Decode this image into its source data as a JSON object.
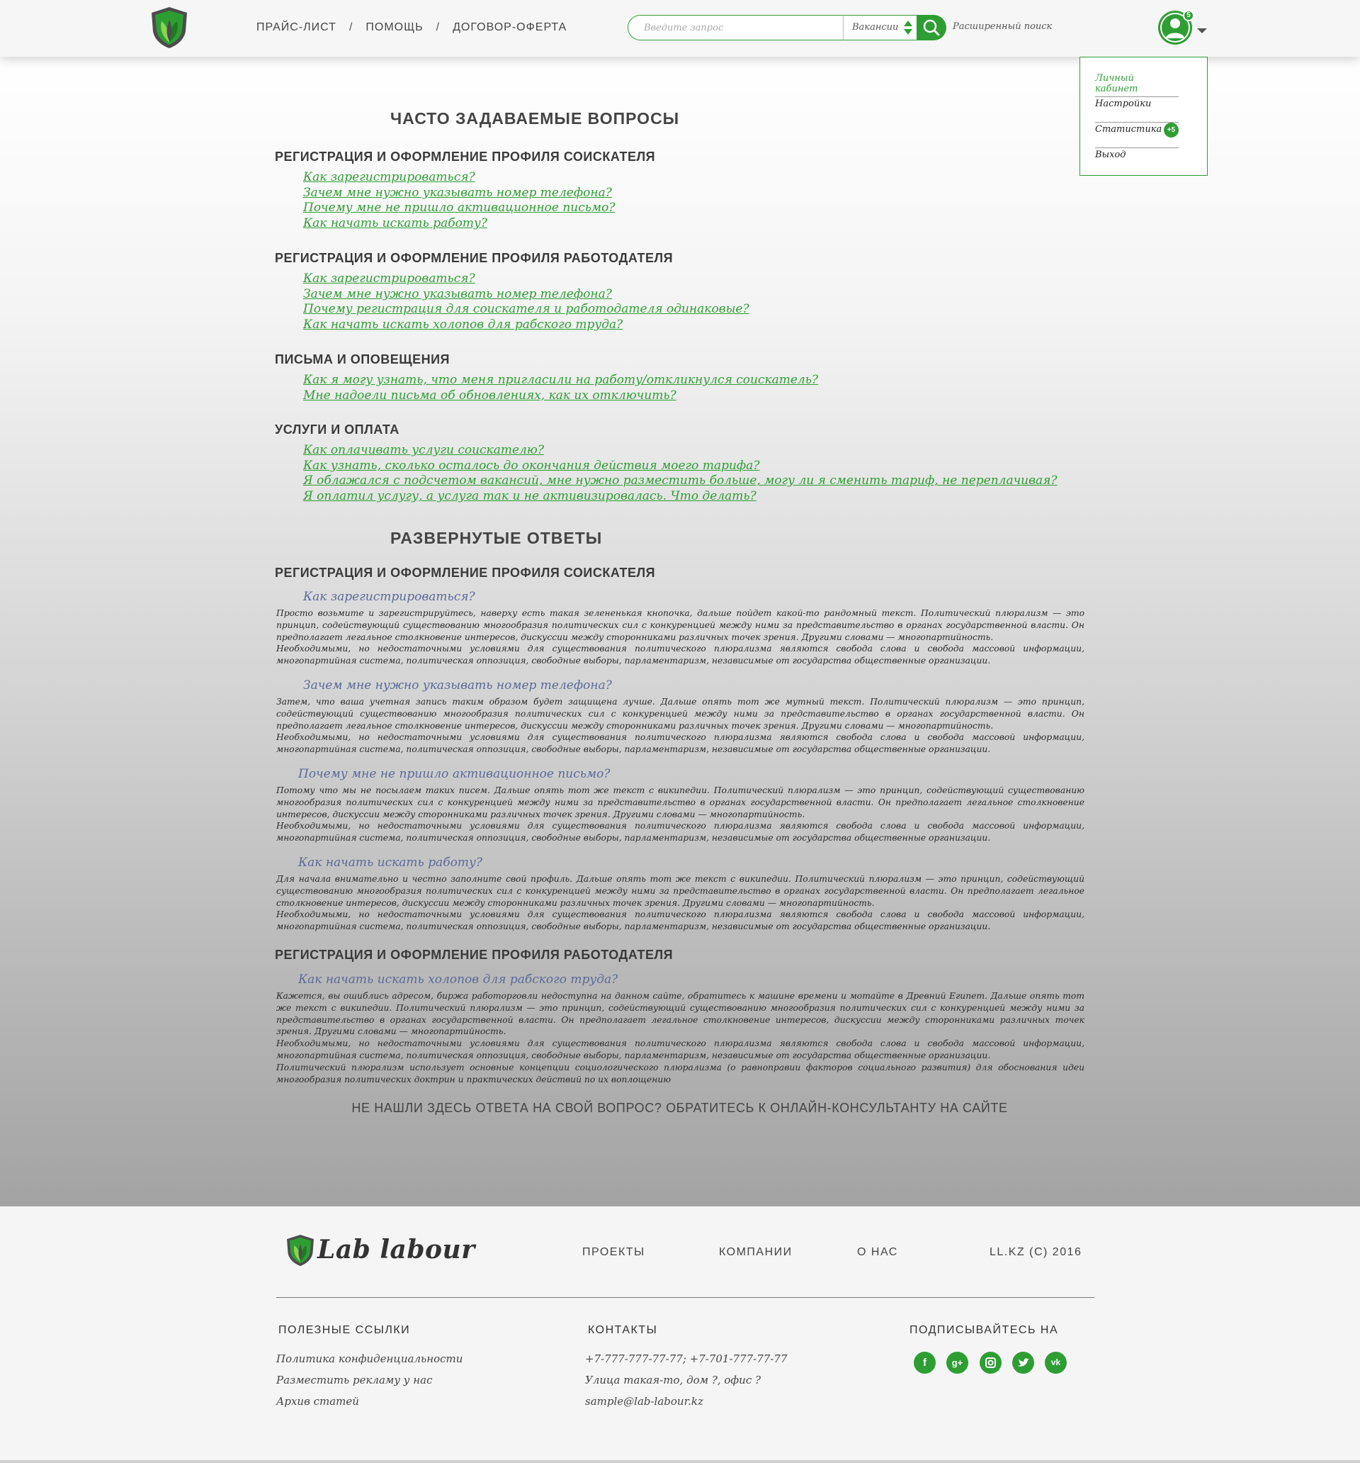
{
  "header": {
    "nav": [
      "ПРАЙС-ЛИСТ",
      "ПОМОЩЬ",
      "ДОГОВОР-ОФЕРТА"
    ],
    "separator": "/",
    "search": {
      "placeholder": "Введите запрос",
      "category": "Вакансии",
      "button_icon": "search-icon"
    },
    "advanced_search": "Расширенный поиск",
    "avatar_badge": "5"
  },
  "user_menu": {
    "items": [
      "Личный кабинет",
      "Настройки",
      "Статистика",
      "Выход"
    ],
    "stats_badge": "+5"
  },
  "faq": {
    "title": "ЧАСТО ЗАДАВАЕМЫЕ ВОПРОСЫ",
    "groups": [
      {
        "title": "РЕГИСТРАЦИЯ И ОФОРМЛЕНИЕ ПРОФИЛЯ СОИСКАТЕЛЯ",
        "links": [
          "Как зарегистрироваться?",
          "Зачем мне нужно указывать номер телефона?",
          "Почему мне не пришло активационное письмо?",
          "Как начать искать работу?"
        ]
      },
      {
        "title": "РЕГИСТРАЦИЯ И ОФОРМЛЕНИЕ ПРОФИЛЯ РАБОТОДАТЕЛЯ",
        "links": [
          "Как зарегистрироваться?",
          "Зачем мне нужно указывать номер телефона?",
          "Почему регистрация для соискателя и работодателя одинаковые?",
          "Как начать искать холопов для рабского труда?"
        ]
      },
      {
        "title": "ПИСЬМА И ОПОВЕЩЕНИЯ",
        "links": [
          "Как я могу узнать, что меня пригласили на работу/откликнулся соискатель?",
          "Мне надоели письма об обновлениях, как их отключить?"
        ]
      },
      {
        "title": "УСЛУГИ И ОПЛАТА",
        "links": [
          "Как оплачивать услуги соискателю?",
          "Как узнать, сколько осталось до окончания действия моего тарифа?",
          "Я облажался с подсчетом вакансий, мне нужно разместить больше, могу ли я сменить тариф, не переплачивая?",
          "Я оплатил услугу, а услуга так и не активизировалась. Что делать?"
        ]
      }
    ]
  },
  "answers": {
    "title": "РАЗВЕРНУТЫЕ ОТВЕТЫ",
    "group1_title": "РЕГИСТРАЦИЯ И ОФОРМЛЕНИЕ ПРОФИЛЯ СОИСКАТЕЛЯ",
    "group2_title": "РЕГИСТРАЦИЯ И ОФОРМЛЕНИЕ ПРОФИЛЯ РАБОТОДАТЕЛЯ",
    "items": [
      {
        "q": "Как зарегистрироваться?",
        "a": "Просто возьмите и зарегистрируйтесь, наверху есть такая зелененькая кнопочка, дальше пойдет какой-то рандомный текст. Политический плюрализм — это принцип, содействующий существованию многообразия политических сил с конкуренцией между ними за представительство в органах государственной власти. Он предполагает легальное столкновение интересов, дискуссии между сторонниками различных точек зрения. Другими словами — многопартийность.\nНеобходимыми, но недостаточными условиями для существования политического плюрализма являются свобода слова и свобода массовой информации, многопартийная система, политическая оппозиция, свободные выборы, парламентаризм, независимые от государства общественные организации."
      },
      {
        "q": "Зачем мне нужно указывать номер телефона?",
        "a": "Затем, что ваша учетная запись таким образом будет защищена лучше. Дальше опять тот же мутный текст. Политический плюрализм — это принцип, содействующий существованию многообразия политических сил с конкуренцией между ними за представительство в органах государственной власти. Он предполагает легальное столкновение интересов, дискуссии между сторонниками различных точек зрения. Другими словами — многопартийность.\nНеобходимыми, но недостаточными условиями для существования политического плюрализма являются свобода слова и свобода массовой информации, многопартийная система, политическая оппозиция, свободные выборы, парламентаризм, независимые от государства общественные организации."
      },
      {
        "q": "Почему мне не пришло активационное письмо?",
        "a": "Потому что мы не посылаем таких писем. Дальше опять тот же текст с википедии. Политический плюрализм — это принцип, содействующий существованию многообразия политических сил с конкуренцией между ними за представительство в органах государственной власти. Он предполагает легальное столкновение интересов, дискуссии между сторонниками различных точек зрения. Другими словами — многопартийность.\nНеобходимыми, но недостаточными условиями для существования политического плюрализма являются свобода слова и свобода массовой информации, многопартийная система, политическая оппозиция, свободные выборы, парламентаризм, независимые от государства общественные организации."
      },
      {
        "q": "Как начать искать работу?",
        "a": "Для начала внимательно и честно заполните свой профиль. Дальше опять тот же текст с википедии. Политический плюрализм — это принцип, содействующий существованию многообразия политических сил с конкуренцией между ними за представительство в органах государственной власти. Он предполагает легальное столкновение интересов, дискуссии между сторонниками различных точек зрения. Другими словами — многопартийность.\nНеобходимыми, но недостаточными условиями для существования политического плюрализма являются свобода слова и свобода массовой информации, многопартийная система, политическая оппозиция, свободные выборы, парламентаризм, независимые от государства общественные организации."
      },
      {
        "q": "Как начать искать холопов для рабского труда?",
        "a": "Кажется, вы ошиблись адресом, биржа работорговли недоступна на данном сайте, обратитесь к машине времени и мотайте в Древний Египет. Дальше опять тот же текст с википедии. Политический плюрализм — это принцип, содействующий существованию многообразия политических сил с конкуренцией между ними за представительство в органах государственной власти. Он предполагает легальное столкновение интересов, дискуссии между сторонниками различных точек зрения. Другими словами — многопартийность.\nНеобходимыми, но недостаточными условиями для существования политического плюрализма являются свобода слова и свобода массовой информации, многопартийная система, политическая оппозиция, свободные выборы, парламентаризм, независимые от государства общественные организации.\nПолитический плюрализм использует основные концепции социологического плюрализма (о равноправии факторов социального развития) для обоснования идеи многообразия политических доктрин и практических действий по их воплощению"
      }
    ],
    "cta": "НЕ НАШЛИ ЗДЕСЬ ОТВЕТА НА СВОЙ ВОПРОС? ОБРАТИТЕСЬ К ОНЛАЙН-КОНСУЛЬТАНТУ НА САЙТЕ"
  },
  "footer": {
    "brand": "Lab labour",
    "nav": [
      "ПРОЕКТЫ",
      "КОМПАНИИ",
      "О НАС"
    ],
    "copyright": "LL.KZ (C) 2016",
    "useful_title": "ПОЛЕЗНЫЕ ССЫЛКИ",
    "useful_links": [
      "Политика конфиденциальности",
      "Разместить рекламу у нас",
      "Архив статей"
    ],
    "contacts_title": "КОНТАКТЫ",
    "contacts": [
      "+7-777-777-77-77; +7-701-777-77-77",
      "Улица такая-то, дом ?, офис ?",
      "sample@lab-labour.kz"
    ],
    "subscribe_title": "ПОДПИСЫВАЙТЕСЬ НА",
    "social": [
      "facebook-icon",
      "google-plus-icon",
      "instagram-icon",
      "twitter-icon",
      "vk-icon"
    ],
    "accent_color": "#2e9e33"
  }
}
